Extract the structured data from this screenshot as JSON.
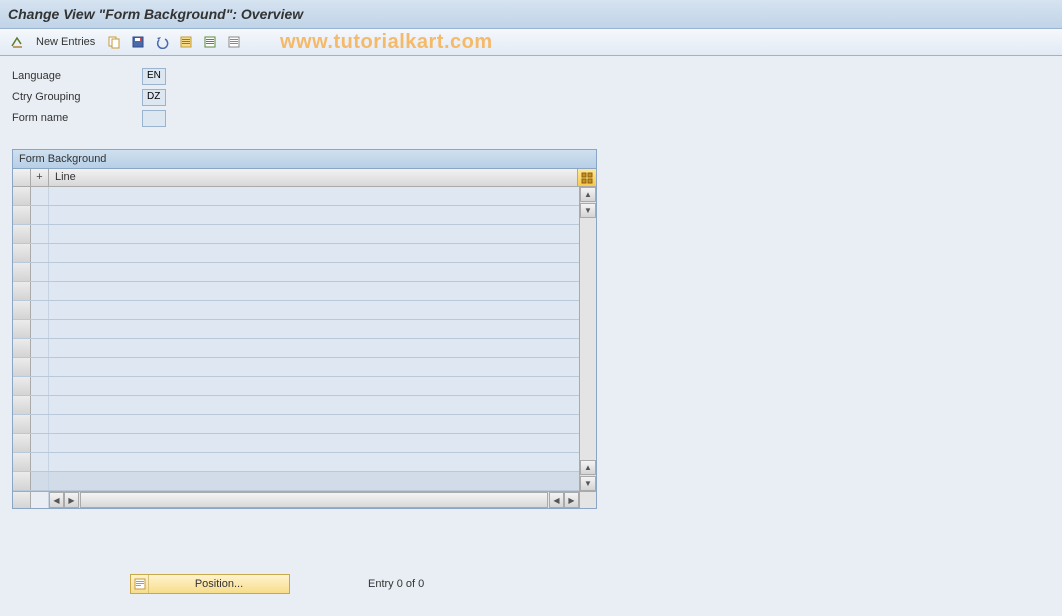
{
  "header": {
    "title": "Change View \"Form Background\": Overview"
  },
  "toolbar": {
    "new_entries_label": "New Entries"
  },
  "watermark": "www.tutorialkart.com",
  "form": {
    "language_label": "Language",
    "language_value": "EN",
    "ctry_label": "Ctry Grouping",
    "ctry_value": "DZ",
    "formname_label": "Form name",
    "formname_value": ""
  },
  "table": {
    "title": "Form Background",
    "col_plus": "+",
    "col_line": "Line",
    "row_count": 16
  },
  "footer": {
    "position_label": "Position...",
    "entry_text": "Entry 0 of 0"
  }
}
